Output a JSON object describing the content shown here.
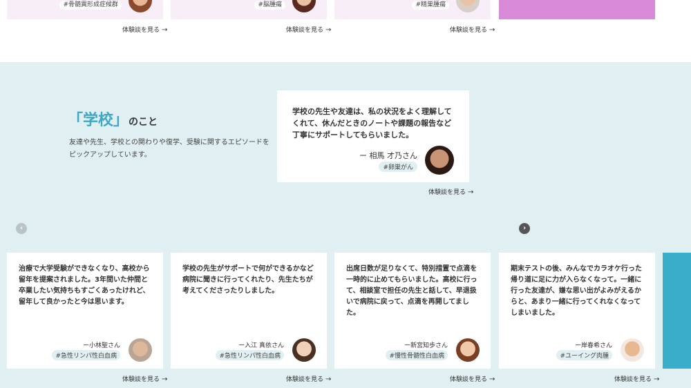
{
  "top_cards": [
    {
      "tag": "#骨髄異形成症候群",
      "read_more": "体験談を見る"
    },
    {
      "tag": "#脳腫瘍",
      "read_more": "体験談を見る"
    },
    {
      "tag": "#精巣腫瘍",
      "read_more": "体験談を見る"
    }
  ],
  "section": {
    "title_keyword": "「学校」",
    "title_suffix": "のこと",
    "description": "友達や先生、学校との関わりや復学、受験に関するエピソードをピックアップしています。"
  },
  "featured": {
    "quote": "学校の先生や友達は、私の状況をよく理解してくれて、休んだときのノートや課題の報告など丁寧にサポートしてもらいました。",
    "author": "ー 相馬 才乃さん",
    "tag": "#卵巣がん",
    "read_more": "体験談を見る"
  },
  "cards": [
    {
      "quote": "治療で大学受験ができなくなり、高校から留年を提案されました。3年間いた仲間と卒業したい気持ちもすごくあったけれど、留年して良かったと今は思います。",
      "author": "ー小林聖さん",
      "tag": "#急性リンパ性白血病",
      "read_more": "体験談を見る"
    },
    {
      "quote": "学校の先生がサポートで何ができるかなど病院に聞きに行ってくれたり、先生たちが考えてくださったりしました。",
      "author": "ー入江 真依さん",
      "tag": "#急性リンパ性白血病",
      "read_more": "体験談を見る"
    },
    {
      "quote": "出席日数が足りなくて、特別措置で点滴を一時的に止めてもらいました。高校に行って、相談室で担任の先生と話して、早退扱いで病院に戻って、点滴を再開してました。",
      "author": "ー新宮知歩さん",
      "tag": "#慢性骨髄性白血病",
      "read_more": "体験談を見る"
    },
    {
      "quote": "期末テストの後、みんなでカラオケ行った帰り道に足に力が入らなくなって。一緒に行った友達が、嫌な思い出がよみがえるからと、あまり一緒に行ってくれなくなってしまいました。",
      "author": "ー岸春希さん",
      "tag": "#ユーイング肉腫",
      "read_more": "体験談を見る"
    }
  ],
  "nav": {
    "prev": "‹",
    "next": "›"
  },
  "icons": {
    "arrow": "→"
  },
  "colors": {
    "accent": "#3fa8c8",
    "section_bg": "#e0eff1",
    "top_card_bg": "#f8eef8",
    "pink_card": "#d98bd9",
    "side_block": "#39adc9"
  }
}
